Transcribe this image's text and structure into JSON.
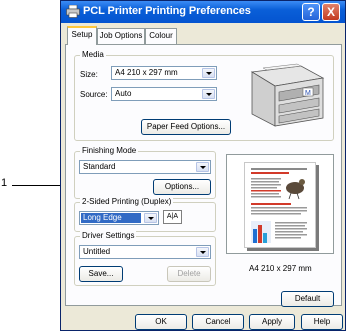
{
  "callout": {
    "number": "1"
  },
  "window": {
    "title": "PCL Printer Printing Preferences",
    "help_button": "?",
    "close_button": "X"
  },
  "tabs": [
    {
      "label": "Setup",
      "active": true
    },
    {
      "label": "Job Options",
      "active": false
    },
    {
      "label": "Colour",
      "active": false
    }
  ],
  "media": {
    "legend": "Media",
    "size_label": "Size:",
    "size_value": "A4 210 x 297 mm",
    "source_label": "Source:",
    "source_value": "Auto",
    "paper_feed_button": "Paper Feed Options..."
  },
  "finishing": {
    "legend": "Finishing Mode",
    "value": "Standard",
    "options_button": "Options..."
  },
  "duplex": {
    "legend": "2-Sided Printing (Duplex)",
    "value": "Long Edge",
    "icon_text": "A|A"
  },
  "driver": {
    "legend": "Driver Settings",
    "value": "Untitled",
    "save_button": "Save...",
    "delete_button": "Delete"
  },
  "preview": {
    "caption": "A4 210 x 297 mm"
  },
  "default_button": "Default",
  "footer": {
    "ok": "OK",
    "cancel": "Cancel",
    "apply": "Apply",
    "help": "Help"
  }
}
